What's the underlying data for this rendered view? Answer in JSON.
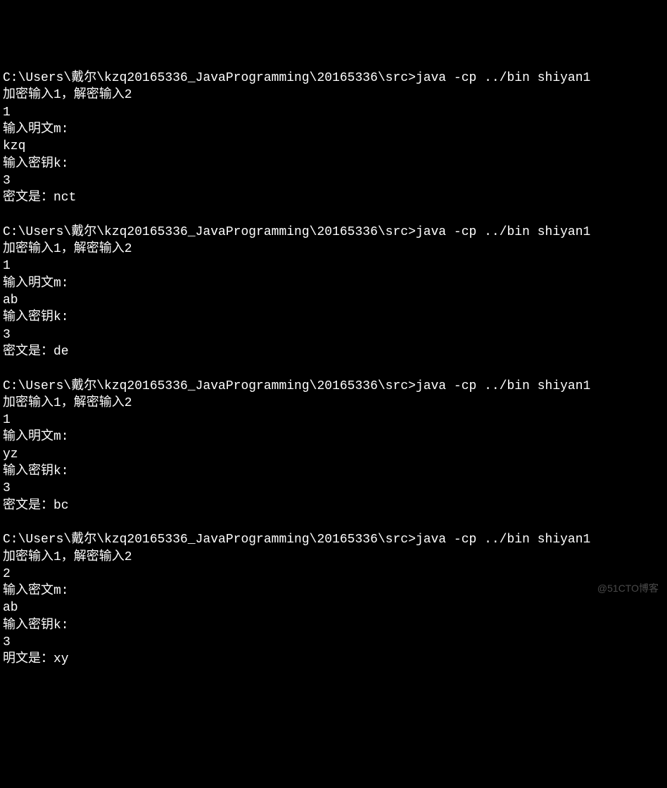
{
  "terminal": {
    "runs": [
      {
        "prompt": "C:\\Users\\戴尔\\kzq20165336_JavaProgramming\\20165336\\src>java -cp ../bin shiyan1",
        "menu": "加密输入1，解密输入2",
        "choice": "1",
        "inputLabel": "输入明文m:",
        "inputValue": "kzq",
        "keyLabel": "输入密钥k:",
        "keyValue": "3",
        "resultLabel": "密文是：",
        "resultValue": "nct"
      },
      {
        "prompt": "C:\\Users\\戴尔\\kzq20165336_JavaProgramming\\20165336\\src>java -cp ../bin shiyan1",
        "menu": "加密输入1，解密输入2",
        "choice": "1",
        "inputLabel": "输入明文m:",
        "inputValue": "ab",
        "keyLabel": "输入密钥k:",
        "keyValue": "3",
        "resultLabel": "密文是：",
        "resultValue": "de"
      },
      {
        "prompt": "C:\\Users\\戴尔\\kzq20165336_JavaProgramming\\20165336\\src>java -cp ../bin shiyan1",
        "menu": "加密输入1，解密输入2",
        "choice": "1",
        "inputLabel": "输入明文m:",
        "inputValue": "yz",
        "keyLabel": "输入密钥k:",
        "keyValue": "3",
        "resultLabel": "密文是：",
        "resultValue": "bc"
      },
      {
        "prompt": "C:\\Users\\戴尔\\kzq20165336_JavaProgramming\\20165336\\src>java -cp ../bin shiyan1",
        "menu": "加密输入1，解密输入2",
        "choice": "2",
        "inputLabel": "输入密文m:",
        "inputValue": "ab",
        "keyLabel": "输入密钥k:",
        "keyValue": "3",
        "resultLabel": "明文是：",
        "resultValue": "xy"
      }
    ]
  },
  "watermark": "@51CTO博客"
}
